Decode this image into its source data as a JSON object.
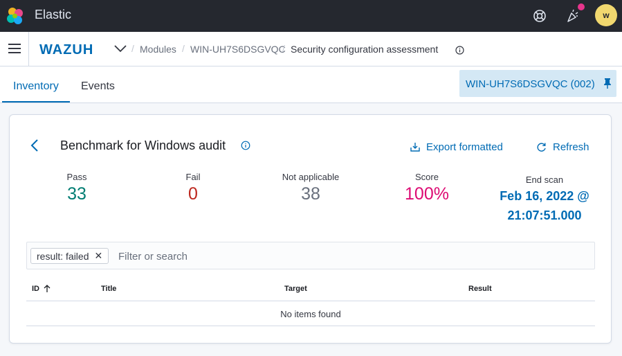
{
  "app": {
    "title": "Elastic",
    "avatar_initial": "w"
  },
  "breadcrumbs": {
    "brand": "WAZUH",
    "items": [
      "Modules",
      "WIN-UH7S6DSGVQC",
      "Security configuration assessment"
    ]
  },
  "tabs": [
    {
      "label": "Inventory",
      "active": true
    },
    {
      "label": "Events",
      "active": false
    }
  ],
  "agent": {
    "label": "WIN-UH7S6DSGVQC (002)"
  },
  "panel": {
    "title": "Benchmark for Windows audit",
    "export_label": "Export formatted",
    "refresh_label": "Refresh"
  },
  "stats": {
    "pass": {
      "label": "Pass",
      "value": "33"
    },
    "fail": {
      "label": "Fail",
      "value": "0"
    },
    "not_applicable": {
      "label": "Not applicable",
      "value": "38"
    },
    "score": {
      "label": "Score",
      "value": "100%"
    },
    "end_scan": {
      "label": "End scan",
      "value_line1": "Feb 16, 2022 @",
      "value_line2": "21:07:51.000"
    }
  },
  "search": {
    "filter_pill": "result: failed",
    "placeholder": "Filter or search",
    "value": ""
  },
  "table": {
    "columns": [
      "ID",
      "Title",
      "Target",
      "Result"
    ],
    "empty_message": "No items found"
  },
  "colors": {
    "accent": "#006bb4",
    "pass": "#017d73",
    "fail": "#bd271e",
    "score": "#dd0a73",
    "topbar": "#25282f"
  }
}
